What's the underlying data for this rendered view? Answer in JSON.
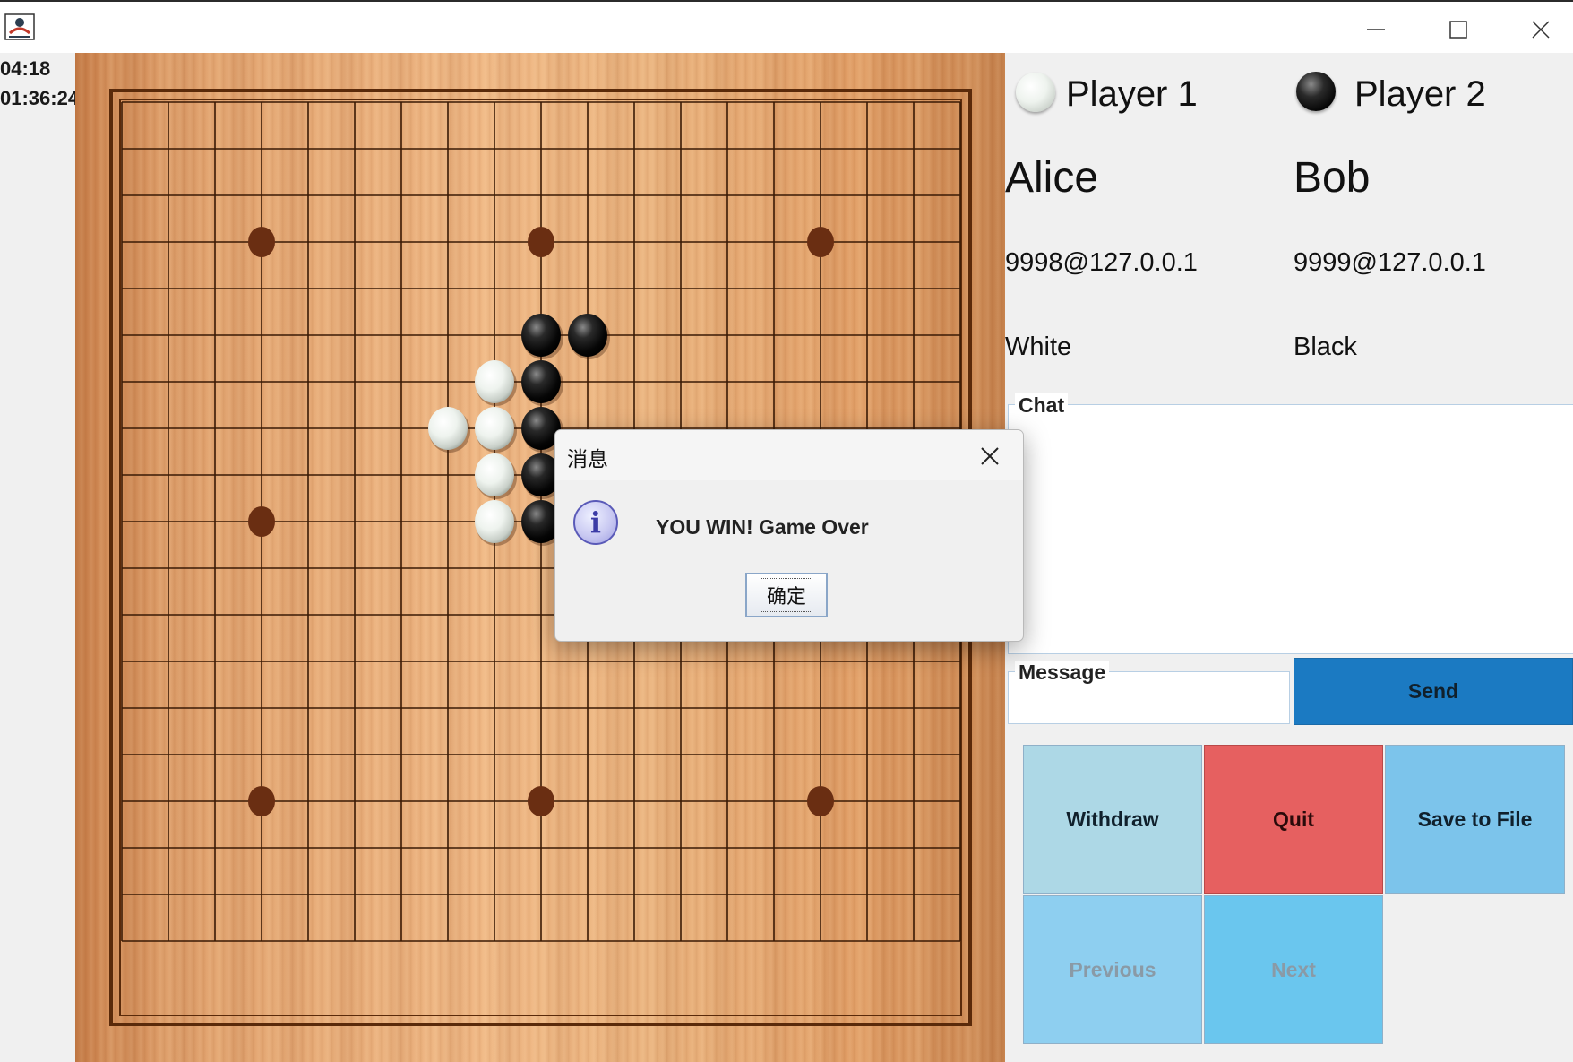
{
  "window": {
    "icon": "java-app-icon",
    "controls": [
      "minimize",
      "maximize",
      "close"
    ]
  },
  "clock": {
    "game_time": "04:18",
    "total_time": "01:36:24"
  },
  "board": {
    "size": 19,
    "star_points": [
      [
        3,
        3
      ],
      [
        3,
        9
      ],
      [
        3,
        15
      ],
      [
        9,
        3
      ],
      [
        15,
        3
      ],
      [
        15,
        9
      ],
      [
        15,
        15
      ]
    ],
    "stones": [
      {
        "row": 5,
        "col": 9,
        "color": "black"
      },
      {
        "row": 5,
        "col": 10,
        "color": "black"
      },
      {
        "row": 6,
        "col": 8,
        "color": "white"
      },
      {
        "row": 6,
        "col": 9,
        "color": "black"
      },
      {
        "row": 7,
        "col": 7,
        "color": "white"
      },
      {
        "row": 7,
        "col": 8,
        "color": "white"
      },
      {
        "row": 7,
        "col": 9,
        "color": "black"
      },
      {
        "row": 8,
        "col": 8,
        "color": "white"
      },
      {
        "row": 8,
        "col": 9,
        "color": "black"
      },
      {
        "row": 9,
        "col": 8,
        "color": "white"
      },
      {
        "row": 9,
        "col": 9,
        "color": "black"
      }
    ]
  },
  "players": {
    "p1": {
      "label": "Player 1",
      "name": "Alice",
      "address": "9998@127.0.0.1",
      "color": "White",
      "stone": "white"
    },
    "p2": {
      "label": "Player 2",
      "name": "Bob",
      "address": "9999@127.0.0.1",
      "color": "Black",
      "stone": "black"
    }
  },
  "chat": {
    "title": "Chat",
    "messages": []
  },
  "message": {
    "title": "Message",
    "value": "",
    "send_label": "Send"
  },
  "actions": {
    "withdraw": "Withdraw",
    "quit": "Quit",
    "save": "Save to File",
    "previous": "Previous",
    "next": "Next"
  },
  "colors": {
    "send": "#1b7ac2",
    "withdraw": "#add8e6",
    "quit": "#e66060",
    "save": "#7cc4eb",
    "previous": "#8ecff0",
    "next": "#6ac6ee",
    "disabled_text": "#8a9aa6"
  },
  "dialog": {
    "title": "消息",
    "message": "YOU WIN! Game Over",
    "ok_label": "确定",
    "icon": "info-icon"
  }
}
